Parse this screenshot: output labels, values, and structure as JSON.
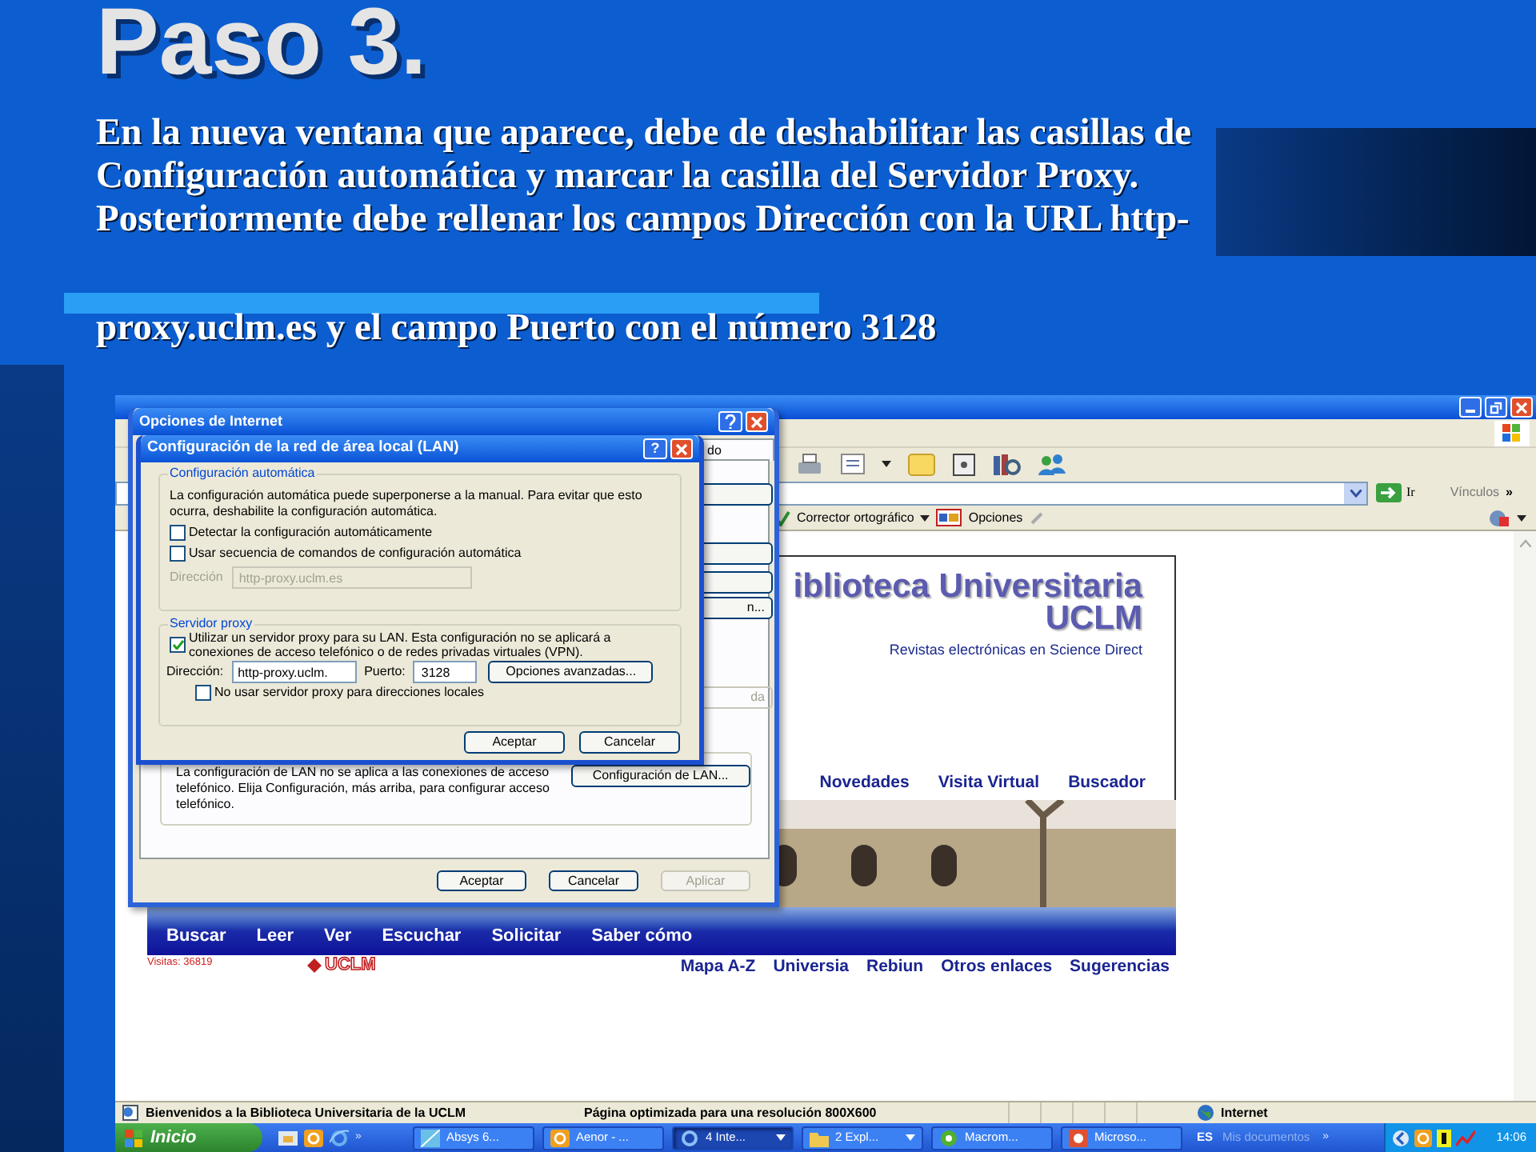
{
  "slide": {
    "title": "Paso 3.",
    "paragraphs": [
      [
        "En la nueva ventana que aparece, debe de deshabilitar las casillas de",
        "Configuración automática y marcar la casilla del Servidor Proxy.",
        "Posteriormente debe rellenar los campos Dirección con la URL http-"
      ],
      [
        "proxy.uclm.es y el campo Puerto con el número 3128"
      ]
    ]
  },
  "browser": {
    "address_bar": {
      "go_button": "Ir",
      "links_label": "Vínculos",
      "links_more": "»"
    },
    "google_bar": {
      "spellcheck": "Corrector ortográfico",
      "options": "Opciones"
    },
    "page": {
      "heading": "iblioteca Universitaria",
      "subheading": "UCLM",
      "link": "Revistas electrónicas en Science Direct",
      "nav": [
        "Novedades",
        "Visita Virtual",
        "Buscador"
      ],
      "menu": [
        "Buscar",
        "Leer",
        "Ver",
        "Escuchar",
        "Solicitar",
        "Saber cómo"
      ],
      "visits": "Visitas: 36819",
      "logo_text": "UCLM",
      "footer_links": [
        "Mapa A-Z",
        "Universia",
        "Rebiun",
        "Otros enlaces",
        "Sugerencias"
      ]
    },
    "status_bar": {
      "message": "Bienvenidos a la Biblioteca Universitaria de la UCLM",
      "note": "Página optimizada para una resolución 800X600",
      "zone": "Internet"
    }
  },
  "taskbar": {
    "start": "Inicio",
    "quick_launch_more": "»",
    "tasks": [
      {
        "label": "Absys 6...",
        "selected": false,
        "has_menu": false
      },
      {
        "label": "Aenor - ...",
        "selected": false,
        "has_menu": false
      },
      {
        "label": "4 Inte...",
        "selected": true,
        "has_menu": true
      },
      {
        "label": "2 Expl...",
        "selected": false,
        "has_menu": true
      },
      {
        "label": "Macrom...",
        "selected": false,
        "has_menu": false
      },
      {
        "label": "Microso...",
        "selected": false,
        "has_menu": false
      }
    ],
    "language": "ES",
    "toolbar": "Mis documentos",
    "toolbar_more": "»",
    "clock": "14:06"
  },
  "internet_options": {
    "title": "Opciones de Internet",
    "tab_fragment": "do",
    "button_fragments": [
      {
        "label": "n...",
        "disabled": false
      },
      {
        "label": "da",
        "disabled": true
      }
    ],
    "lan_note": "La configuración de LAN no se aplica a las conexiones de acceso telefónico. Elija Configuración, más arriba, para configurar acceso telefónico.",
    "lan_button": "Configuración de LAN...",
    "buttons": [
      {
        "label": "Aceptar",
        "disabled": false
      },
      {
        "label": "Cancelar",
        "disabled": false
      },
      {
        "label": "Aplicar",
        "disabled": true
      }
    ]
  },
  "lan_dialog": {
    "title": "Configuración de la red de área local (LAN)",
    "help": "?",
    "auto_group": {
      "legend": "Configuración automática",
      "note": "La configuración automática puede superponerse a la manual. Para evitar que esto ocurra, deshabilite la configuración automática.",
      "options": [
        {
          "label": "Detectar la configuración automáticamente",
          "checked": false
        },
        {
          "label": "Usar secuencia de comandos de configuración automática",
          "checked": false
        }
      ],
      "address_label": "Dirección",
      "address_value": "http-proxy.uclm.es",
      "disabled": true
    },
    "proxy_group": {
      "legend": "Servidor proxy",
      "use_proxy": {
        "label": "Utilizar un servidor proxy para su LAN. Esta configuración no se aplicará a conexiones de acceso telefónico o de redes privadas virtuales (VPN).",
        "checked": true
      },
      "address_label": "Dirección:",
      "address_value": "http-proxy.uclm.",
      "port_label": "Puerto:",
      "port_value": "3128",
      "advanced_button": "Opciones avanzadas...",
      "bypass": {
        "label": "No usar servidor proxy para direcciones locales",
        "checked": false
      }
    },
    "buttons": [
      "Aceptar",
      "Cancelar"
    ]
  }
}
